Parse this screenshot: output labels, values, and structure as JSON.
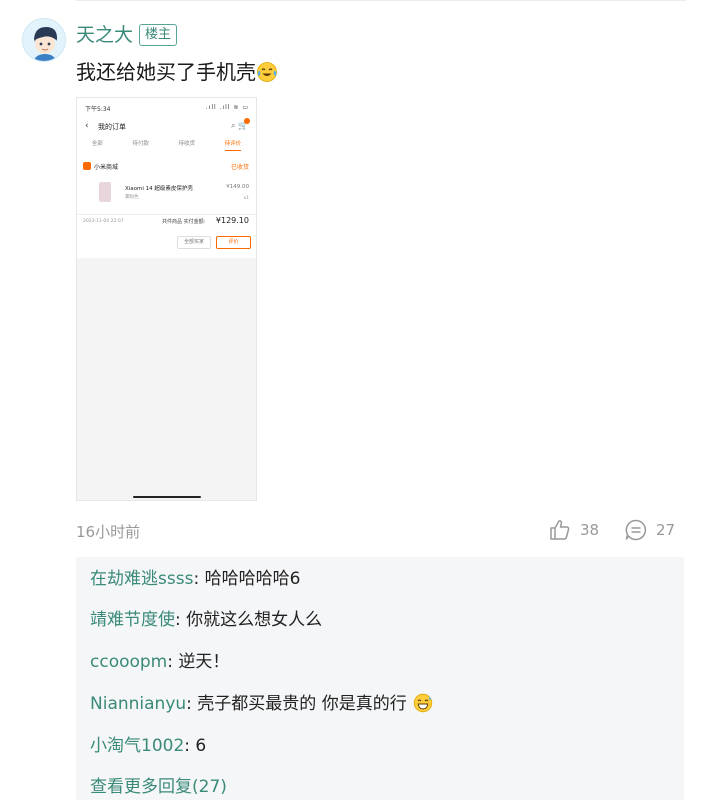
{
  "post": {
    "author": "天之大",
    "op_badge": "楼主",
    "text": "我还给她买了手机壳",
    "text_emoji": "crying-laughing-emoji",
    "timestamp": "16小时前",
    "likes": "38",
    "comments": "27"
  },
  "screenshot": {
    "status_time": "下午5:34",
    "status_icons": ".ıll .ıll ≋ ▭",
    "nav_title": "我的订单",
    "tabs": [
      {
        "label": "全部",
        "active": false
      },
      {
        "label": "待付款",
        "active": false
      },
      {
        "label": "待收货",
        "active": false
      },
      {
        "label": "待评价",
        "active": true
      }
    ],
    "store_name": "小米商城",
    "order_status": "已收货",
    "product_name": "Xiaomi 14 超级素皮保护壳",
    "product_spec": "雾粉色",
    "product_price": "¥149.00",
    "product_qty": "x1",
    "order_date": "2023-11-04 22:07",
    "order_total_label": "共件商品  实付金额:",
    "order_total": "¥129.10",
    "rebuy_button": "全部买家",
    "review_button": "评价",
    "accent_color": "#ff6a00"
  },
  "replies": [
    {
      "author": "在劫难逃ssss",
      "text": "哈哈哈哈哈6"
    },
    {
      "author": "靖难节度使",
      "text": "你就这么想女人么"
    },
    {
      "author": "ccooopm",
      "text": "逆天！"
    },
    {
      "author": "Niannianyu",
      "text": "壳子都买最贵的 你是真的行",
      "emoji": "grinning-sweat-emoji"
    },
    {
      "author": "小淘气1002",
      "text": "6"
    }
  ],
  "more_replies": "查看更多回复(27)",
  "colors": {
    "username": "#3a8a79",
    "muted": "#999999",
    "reply_bg": "#f5f6f7"
  }
}
